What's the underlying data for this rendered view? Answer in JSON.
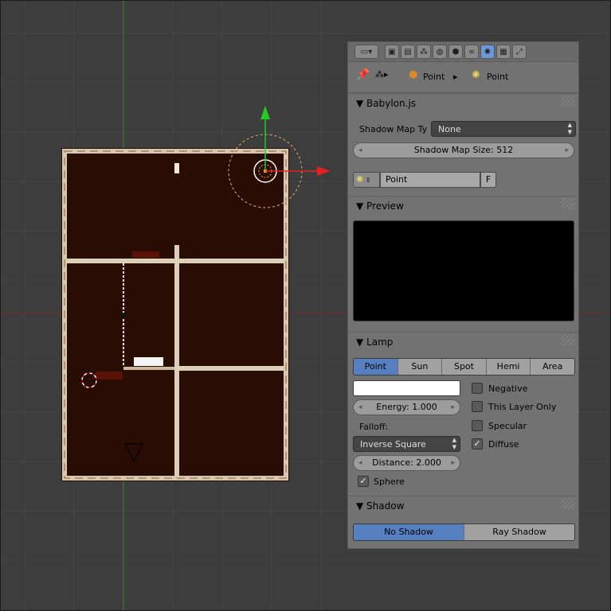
{
  "colors": {
    "background": "#3d3d3d",
    "accent": "#5680c2",
    "panel": "#727272",
    "floor": "#2a0d02",
    "axis_x": "#e22222",
    "axis_y": "#22cc22"
  },
  "header": {
    "editor_type_icon": "properties-editor-icon",
    "context_icons": [
      "render-icon",
      "render-layers-icon",
      "scene-icon",
      "world-icon",
      "object-icon",
      "constraints-icon",
      "object-data-lamp-icon",
      "texture-icon",
      "modifiers-icon"
    ]
  },
  "breadcrumbs": {
    "object_label": "Point",
    "data_label": "Point"
  },
  "babylon": {
    "title": "Babylon.js",
    "shadow_map_type_label": "Shadow Map Ty",
    "shadow_map_type_value": "None",
    "shadow_map_size": "Shadow Map Size: 512"
  },
  "datablock": {
    "name": "Point",
    "fake_user": "F"
  },
  "preview": {
    "title": "Preview"
  },
  "lamp": {
    "title": "Lamp",
    "types": [
      "Point",
      "Sun",
      "Spot",
      "Hemi",
      "Area"
    ],
    "selected_type": "Point",
    "color": "#ffffff",
    "energy": "Energy: 1.000",
    "falloff_label": "Falloff:",
    "falloff_value": "Inverse Square",
    "distance": "Distance: 2.000",
    "negative": {
      "label": "Negative",
      "checked": false
    },
    "this_layer_only": {
      "label": "This Layer Only",
      "checked": false
    },
    "specular": {
      "label": "Specular",
      "checked": false
    },
    "diffuse": {
      "label": "Diffuse",
      "checked": true
    },
    "sphere": {
      "label": "Sphere",
      "checked": true
    }
  },
  "shadow": {
    "title": "Shadow",
    "options": [
      "No Shadow",
      "Ray Shadow"
    ],
    "selected": "No Shadow"
  }
}
